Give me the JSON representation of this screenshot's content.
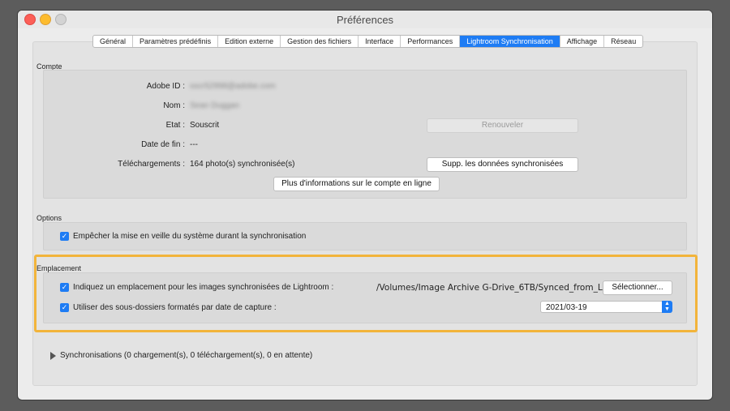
{
  "window": {
    "title": "Préférences"
  },
  "tabs": [
    {
      "label": "Général"
    },
    {
      "label": "Paramètres prédéfinis"
    },
    {
      "label": "Edition externe"
    },
    {
      "label": "Gestion des fichiers"
    },
    {
      "label": "Interface"
    },
    {
      "label": "Performances"
    },
    {
      "label": "Lightroom Synchronisation"
    },
    {
      "label": "Affichage"
    },
    {
      "label": "Réseau"
    }
  ],
  "active_tab": "Lightroom Synchronisation",
  "compte": {
    "heading": "Compte",
    "adobe_id_label": "Adobe ID :",
    "adobe_id_value": "sscr52998@adobe.com",
    "nom_label": "Nom :",
    "nom_value": "Sean Duggan",
    "etat_label": "Etat :",
    "etat_value": "Souscrit",
    "renouveler_label": "Renouveler",
    "date_fin_label": "Date de fin :",
    "date_fin_value": "---",
    "telechargements_label": "Téléchargements :",
    "telechargements_value": "164 photo(s) synchronisée(s)",
    "supp_label": "Supp. les données synchronisées",
    "plus_info_label": "Plus d'informations sur le compte en ligne"
  },
  "options": {
    "heading": "Options",
    "veille_label": "Empêcher la mise en veille du système durant la synchronisation",
    "veille_checked": true
  },
  "emplacement": {
    "heading": "Emplacement",
    "indiquez_label": "Indiquez un emplacement pour les images synchronisées de Lightroom :",
    "indiquez_checked": true,
    "path_value": "/Volumes/Image Archive G-Drive_6TB/Synced_from_LR",
    "selectionner_label": "Sélectionner...",
    "sous_dossiers_label": "Utiliser des sous-dossiers formatés par date de capture :",
    "sous_dossiers_checked": true,
    "date_format_value": "2021/03-19"
  },
  "sync_status": "Synchronisations (0 chargement(s), 0 téléchargement(s), 0 en attente)",
  "colors": {
    "accent": "#1e7cf4",
    "highlight": "#f2b43b"
  }
}
